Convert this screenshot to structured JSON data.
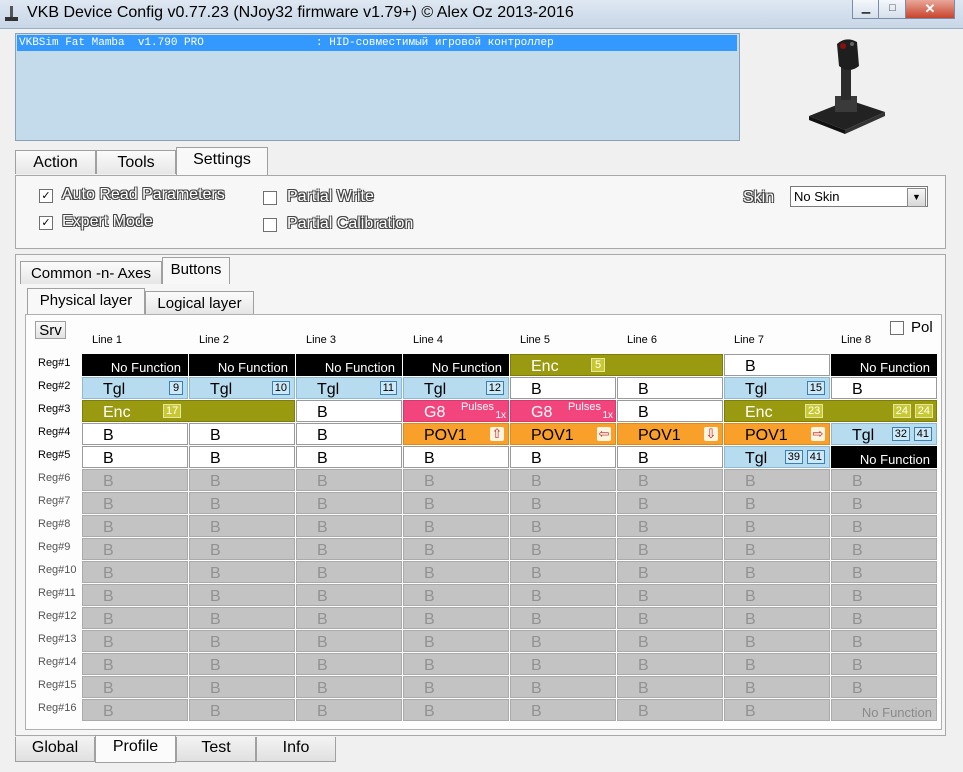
{
  "window": {
    "title": "VKB Device Config v0.77.23 (NJoy32 firmware v1.79+) © Alex Oz 2013-2016",
    "minimize": "▁",
    "maximize": "□",
    "close": "✕"
  },
  "device_list": {
    "row": "VKBSim Fat Mamba  v1.790 PRO                 : HID-совместимый игровой контроллер"
  },
  "top_tabs": [
    "Action",
    "Tools",
    "Settings"
  ],
  "settings": {
    "auto_read": {
      "label": "Auto Read Parameters",
      "checked": true
    },
    "expert_mode": {
      "label": "Expert Mode",
      "checked": true
    },
    "partial_write": {
      "label": "Partial Write",
      "checked": false
    },
    "partial_calibration": {
      "label": "Partial Calibration",
      "checked": false
    },
    "skin_label": "Skin",
    "skin_value": "No Skin"
  },
  "section_tabs": [
    "Common -n- Axes",
    "Buttons"
  ],
  "layer_tabs": [
    "Physical layer",
    "Logical layer"
  ],
  "grid": {
    "srv_label": "Srv",
    "pol_label": "Pol",
    "columns": [
      "Line 1",
      "Line 2",
      "Line 3",
      "Line 4",
      "Line 5",
      "Line 6",
      "Line 7",
      "Line 8"
    ],
    "rows": [
      "Reg#1",
      "Reg#2",
      "Reg#3",
      "Reg#4",
      "Reg#5",
      "Reg#6",
      "Reg#7",
      "Reg#8",
      "Reg#9",
      "Reg#10",
      "Reg#11",
      "Reg#12",
      "Reg#13",
      "Reg#14",
      "Reg#15",
      "Reg#16"
    ],
    "cells": [
      [
        {
          "type": "nofn",
          "text": "No Function"
        },
        {
          "type": "nofn",
          "text": "No Function"
        },
        {
          "type": "nofn",
          "text": "No Function"
        },
        {
          "type": "nofn",
          "text": "No Function"
        },
        {
          "type": "enc",
          "text": "Enc",
          "span": 2,
          "badges": [
            "5"
          ]
        },
        null,
        {
          "type": "b",
          "text": "B"
        },
        {
          "type": "nofn",
          "text": "No Function"
        }
      ],
      [
        {
          "type": "tgl",
          "text": "Tgl",
          "badges": [
            "9"
          ]
        },
        {
          "type": "tgl",
          "text": "Tgl",
          "badges": [
            "10"
          ]
        },
        {
          "type": "tgl",
          "text": "Tgl",
          "badges": [
            "11"
          ]
        },
        {
          "type": "tgl",
          "text": "Tgl",
          "badges": [
            "12"
          ]
        },
        {
          "type": "b",
          "text": "B"
        },
        {
          "type": "b",
          "text": "B"
        },
        {
          "type": "tgl",
          "text": "Tgl",
          "badges": [
            "15"
          ]
        },
        {
          "type": "b",
          "text": "B"
        }
      ],
      [
        {
          "type": "enc",
          "text": "Enc",
          "span": 2,
          "badges": [
            "17"
          ]
        },
        null,
        {
          "type": "b",
          "text": "B"
        },
        {
          "type": "g8",
          "text": "G8",
          "sub1": "Pulses",
          "sub2": "1x"
        },
        {
          "type": "g8",
          "text": "G8",
          "sub1": "Pulses",
          "sub2": "1x"
        },
        {
          "type": "b",
          "text": "B"
        },
        {
          "type": "enc",
          "text": "Enc",
          "span": 2,
          "badges": [
            "23"
          ],
          "end_badges": [
            "24",
            "24"
          ]
        },
        null
      ],
      [
        {
          "type": "b",
          "text": "B"
        },
        {
          "type": "b",
          "text": "B"
        },
        {
          "type": "b",
          "text": "B"
        },
        {
          "type": "pov",
          "text": "POV1",
          "arrow": "⇧"
        },
        {
          "type": "pov",
          "text": "POV1",
          "arrow": "⇦"
        },
        {
          "type": "pov",
          "text": "POV1",
          "arrow": "⇩"
        },
        {
          "type": "pov",
          "text": "POV1",
          "arrow": "⇨"
        },
        {
          "type": "tgl",
          "text": "Tgl",
          "badges": [
            "32",
            "41"
          ]
        }
      ],
      [
        {
          "type": "b",
          "text": "B"
        },
        {
          "type": "b",
          "text": "B"
        },
        {
          "type": "b",
          "text": "B"
        },
        {
          "type": "b",
          "text": "B"
        },
        {
          "type": "b",
          "text": "B"
        },
        {
          "type": "b",
          "text": "B"
        },
        {
          "type": "tgl",
          "text": "Tgl",
          "badges": [
            "39",
            "41"
          ]
        },
        {
          "type": "nofn",
          "text": "No Function"
        }
      ]
    ],
    "empty_cell_text": "B",
    "last_cell_text": "No Function"
  },
  "bottom_tabs": [
    "Global",
    "Profile",
    "Test",
    "Info"
  ]
}
